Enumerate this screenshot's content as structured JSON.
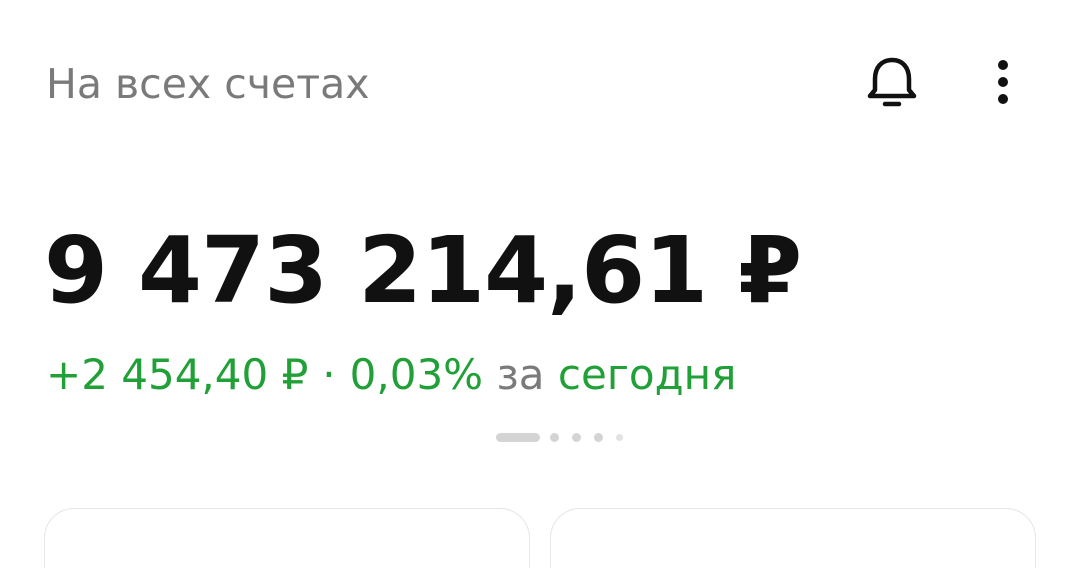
{
  "header": {
    "title": "На всех счетах",
    "bell_icon": "bell-icon",
    "more_icon": "more-vertical-icon"
  },
  "balance": {
    "amount": "9 473 214,61 ₽"
  },
  "change": {
    "amount": "+2 454,40 ₽",
    "separator": "·",
    "percent": "0,03%",
    "for_word": "за",
    "period": "сегодня"
  },
  "pager": {
    "total_pages": 5,
    "active_page": 1
  },
  "colors": {
    "accent_green": "#21a038",
    "muted_text": "#7a7a7a",
    "primary_text": "#111111"
  }
}
